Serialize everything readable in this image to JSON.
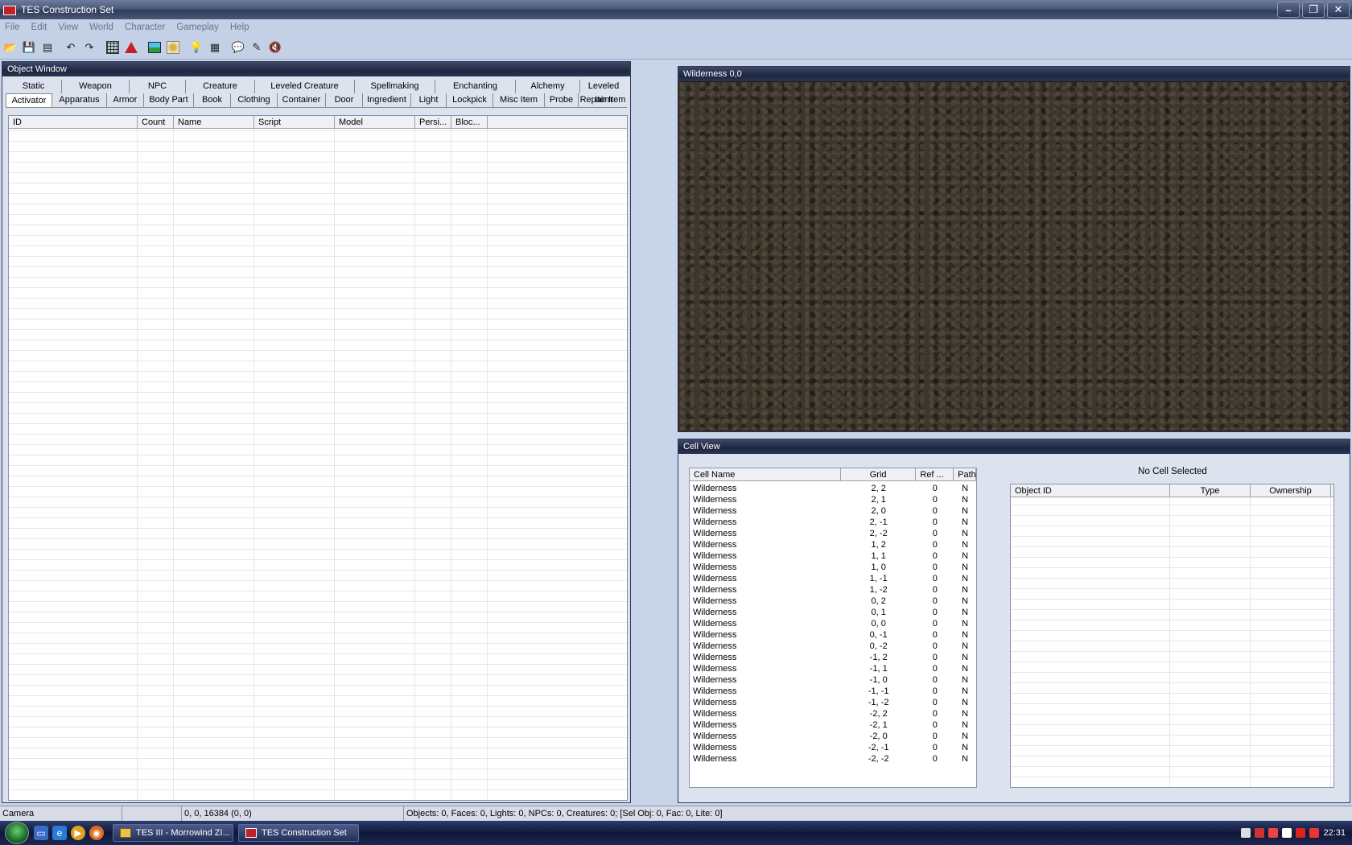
{
  "window": {
    "title": "TES Construction Set",
    "min": "–",
    "max": "❐",
    "close": "✕"
  },
  "menu": [
    "File",
    "Edit",
    "View",
    "World",
    "Character",
    "Gameplay",
    "Help"
  ],
  "object_window": {
    "title": "Object Window",
    "tabs_row1": [
      "Static",
      "Weapon",
      "NPC",
      "Creature",
      "Leveled Creature",
      "Spellmaking",
      "Enchanting",
      "Alchemy",
      "Leveled Item"
    ],
    "tabs_row2": [
      "Activator",
      "Apparatus",
      "Armor",
      "Body Part",
      "Book",
      "Clothing",
      "Container",
      "Door",
      "Ingredient",
      "Light",
      "Lockpick",
      "Misc Item",
      "Probe",
      "Repair Item"
    ],
    "active_tab": "Activator",
    "columns": [
      "ID",
      "Count",
      "Name",
      "Script",
      "Model",
      "Persi...",
      "Bloc..."
    ]
  },
  "render_window": {
    "title": "Wilderness 0,0"
  },
  "cell_view": {
    "title": "Cell View",
    "columns": [
      "Cell Name",
      "Grid",
      "Ref ...",
      "Path"
    ],
    "rows": [
      [
        "Wilderness",
        "2, 2",
        "0",
        "N"
      ],
      [
        "Wilderness",
        "2, 1",
        "0",
        "N"
      ],
      [
        "Wilderness",
        "2, 0",
        "0",
        "N"
      ],
      [
        "Wilderness",
        "2, -1",
        "0",
        "N"
      ],
      [
        "Wilderness",
        "2, -2",
        "0",
        "N"
      ],
      [
        "Wilderness",
        "1, 2",
        "0",
        "N"
      ],
      [
        "Wilderness",
        "1, 1",
        "0",
        "N"
      ],
      [
        "Wilderness",
        "1, 0",
        "0",
        "N"
      ],
      [
        "Wilderness",
        "1, -1",
        "0",
        "N"
      ],
      [
        "Wilderness",
        "1, -2",
        "0",
        "N"
      ],
      [
        "Wilderness",
        "0, 2",
        "0",
        "N"
      ],
      [
        "Wilderness",
        "0, 1",
        "0",
        "N"
      ],
      [
        "Wilderness",
        "0, 0",
        "0",
        "N"
      ],
      [
        "Wilderness",
        "0, -1",
        "0",
        "N"
      ],
      [
        "Wilderness",
        "0, -2",
        "0",
        "N"
      ],
      [
        "Wilderness",
        "-1, 2",
        "0",
        "N"
      ],
      [
        "Wilderness",
        "-1, 1",
        "0",
        "N"
      ],
      [
        "Wilderness",
        "-1, 0",
        "0",
        "N"
      ],
      [
        "Wilderness",
        "-1, -1",
        "0",
        "N"
      ],
      [
        "Wilderness",
        "-1, -2",
        "0",
        "N"
      ],
      [
        "Wilderness",
        "-2, 2",
        "0",
        "N"
      ],
      [
        "Wilderness",
        "-2, 1",
        "0",
        "N"
      ],
      [
        "Wilderness",
        "-2, 0",
        "0",
        "N"
      ],
      [
        "Wilderness",
        "-2, -1",
        "0",
        "N"
      ],
      [
        "Wilderness",
        "-2, -2",
        "0",
        "N"
      ]
    ],
    "no_cell_label": "No Cell Selected",
    "object_columns": [
      "Object ID",
      "Type",
      "Ownership"
    ]
  },
  "status": {
    "mode": "Camera",
    "empty": "",
    "coords": "0, 0, 16384 (0, 0)",
    "info": "Objects: 0, Faces: 0, Lights: 0, NPCs: 0, Creatures: 0; [Sel Obj: 0, Fac: 0, Lite: 0]"
  },
  "taskbar": {
    "tasks": [
      "TES III - Morrowind ZI...",
      "TES Construction Set"
    ],
    "clock": "22:31"
  },
  "colors": {
    "title_bar": "#2f3b58",
    "panel_bg": "#dde3ee",
    "ground": "#3d362c"
  }
}
